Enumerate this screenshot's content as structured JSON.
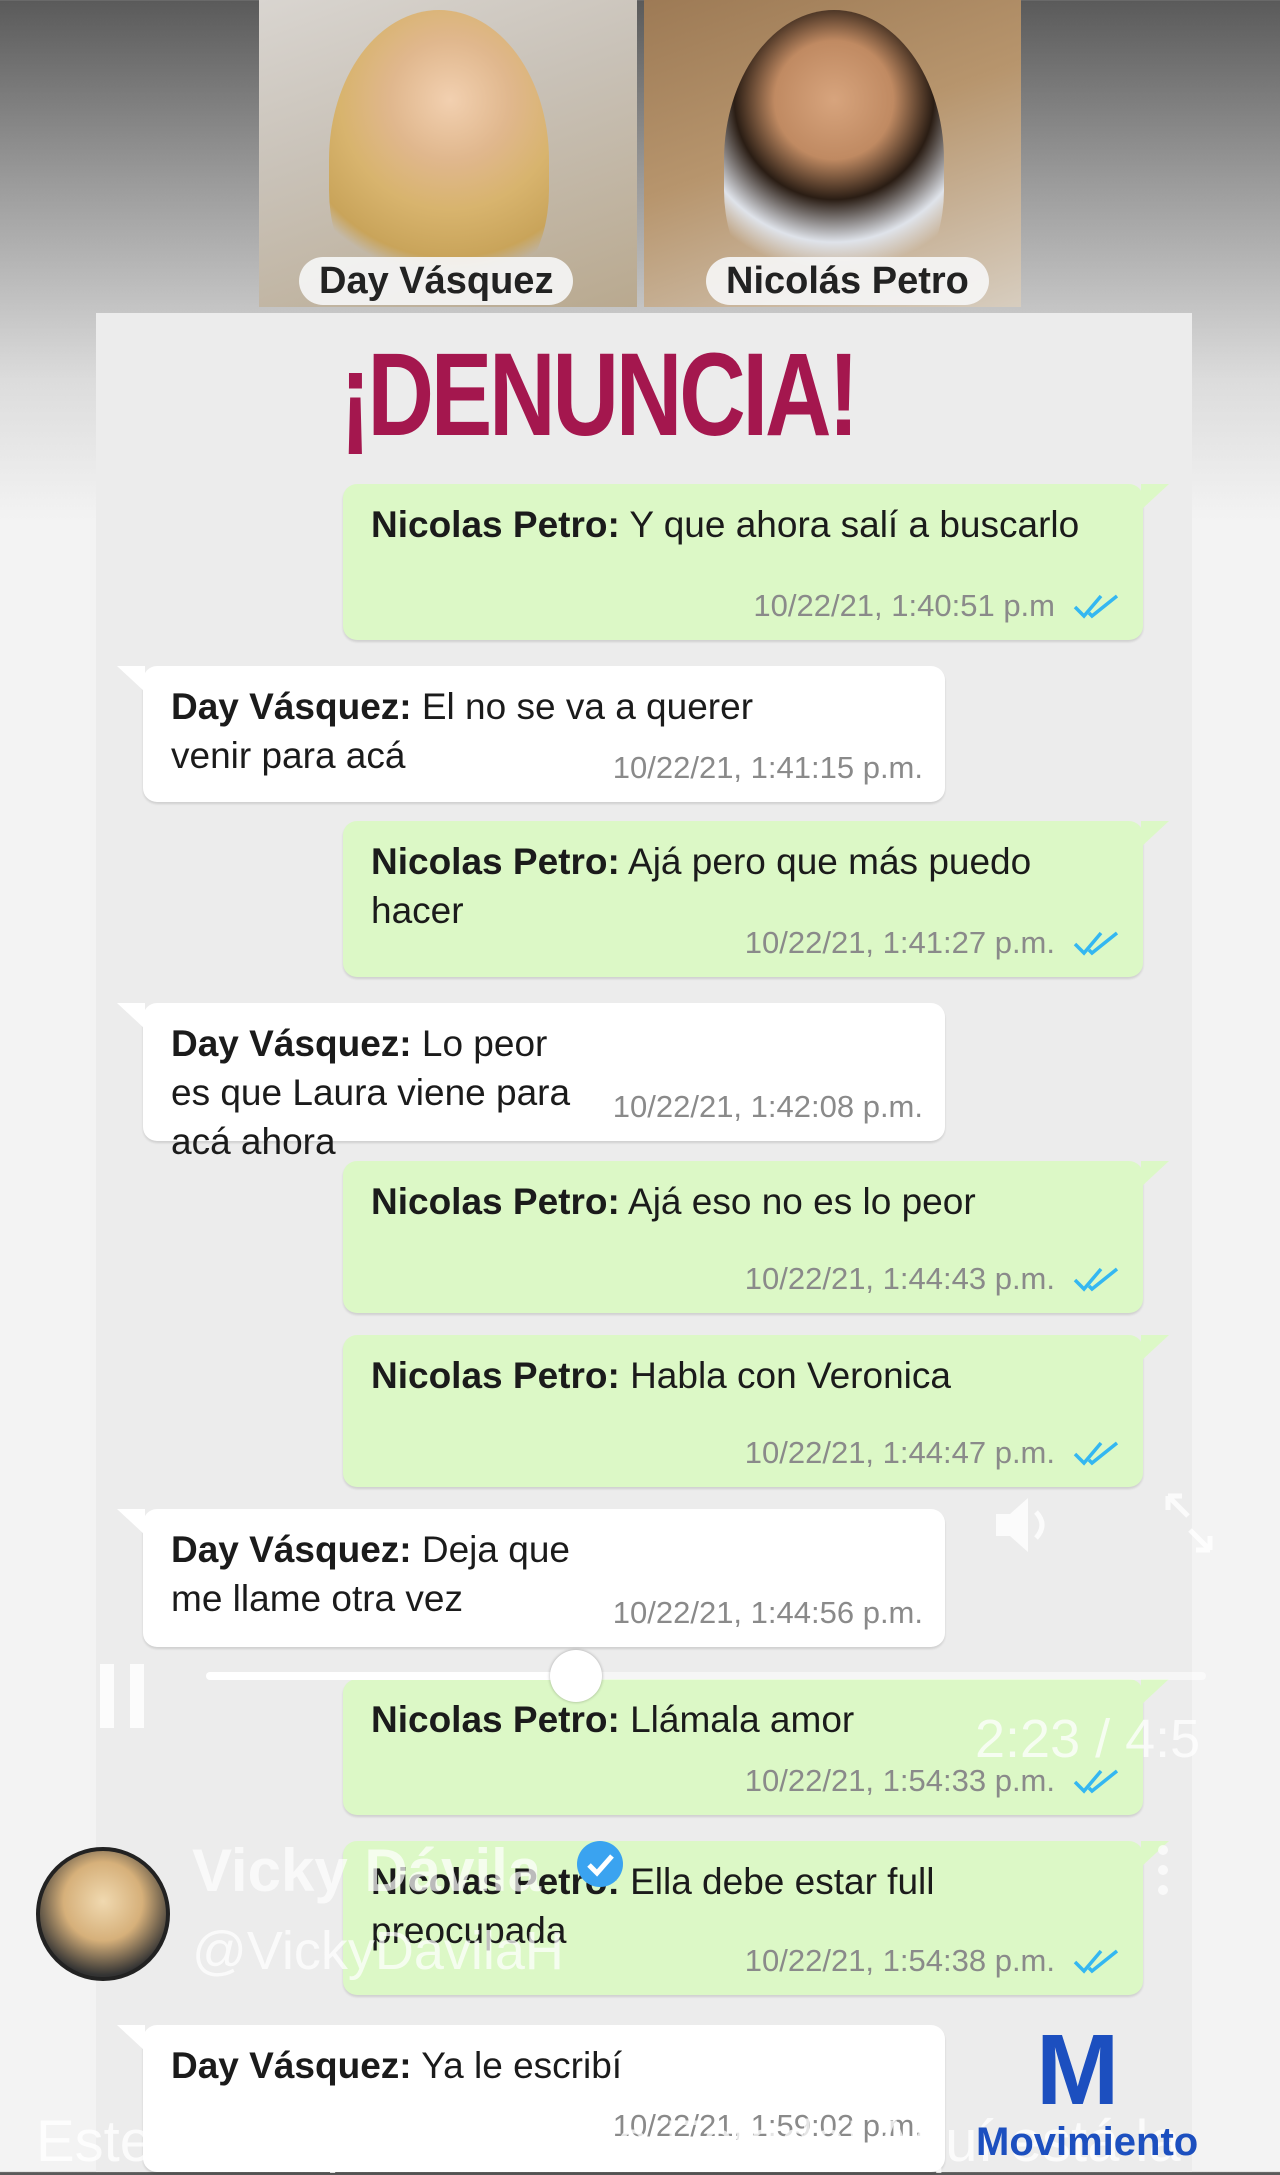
{
  "header": {
    "left_name": "Day Vásquez",
    "right_name": "Nicolás Petro",
    "headline": "¡DENUNCIA!"
  },
  "messages": [
    {
      "sender": "Nicolas Petro:",
      "text": " Y que ahora salí a buscarlo",
      "time": "10/22/21, 1:40:51 p.m",
      "dir": "out"
    },
    {
      "sender": "Day Vásquez:",
      "text": " El no se va a querer venir para acá",
      "time": "10/22/21, 1:41:15 p.m.",
      "dir": "in"
    },
    {
      "sender": "Nicolas Petro:",
      "text": " Ajá pero que más puedo hacer",
      "time": "10/22/21, 1:41:27 p.m.",
      "dir": "out"
    },
    {
      "sender": "Day Vásquez:",
      "text": " Lo peor es que Laura viene para acá ahora",
      "time": "10/22/21, 1:42:08 p.m.",
      "dir": "in"
    },
    {
      "sender": "Nicolas Petro:",
      "text": " Ajá eso no es lo peor",
      "time": "10/22/21, 1:44:43 p.m.",
      "dir": "out"
    },
    {
      "sender": "Nicolas Petro:",
      "text": " Habla con Veronica",
      "time": "10/22/21, 1:44:47 p.m.",
      "dir": "out"
    },
    {
      "sender": "Day Vásquez:",
      "text": " Deja que me llame otra vez",
      "time": "10/22/21, 1:44:56 p.m.",
      "dir": "in"
    },
    {
      "sender": "Nicolas Petro:",
      "text": " Llámala amor",
      "time": "10/22/21, 1:54:33 p.m.",
      "dir": "out"
    },
    {
      "sender": "Nicolas Petro:",
      "text": " Ella debe estar full preocupada",
      "time": "10/22/21, 1:54:38 p.m.",
      "dir": "out"
    },
    {
      "sender": "Day Vásquez:",
      "text": " Ya le escribí",
      "time": "10/22/21, 1:59:02 p.m.",
      "dir": "in"
    }
  ],
  "video_overlay": {
    "channel_name": "Vicky Dávila",
    "handle": "@VickyDavilaH",
    "time_display": "2:23 / 4:5",
    "progress_fraction": 0.37,
    "caption": "Este es un problema de Estado! Aquí está la",
    "logo_letter": "M",
    "logo_text": "Movimiento"
  },
  "colors": {
    "outgoing_bubble": "#dcf8c6",
    "incoming_bubble": "#ffffff",
    "headline": "#a4174e",
    "read_ticks": "#34b7f1"
  },
  "icons": [
    "double-check-icon",
    "verified-badge-icon",
    "volume-icon",
    "pause-icon",
    "more-options-icon",
    "fullscreen-icon"
  ]
}
